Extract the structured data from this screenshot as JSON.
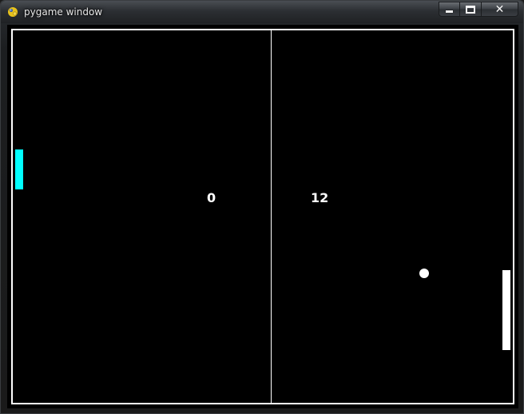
{
  "window": {
    "title": "pygame window",
    "icon": "pygame-snake-icon",
    "controls": {
      "minimize_icon": "minimize-icon",
      "maximize_icon": "maximize-icon",
      "close_icon": "close-icon",
      "close_glyph": "✕"
    }
  },
  "game": {
    "scores": {
      "left": "0",
      "right": "12"
    },
    "colors": {
      "background": "#000000",
      "court_lines": "#ffffff",
      "left_paddle": "#00ffff",
      "right_paddle": "#ffffff",
      "ball": "#ffffff"
    }
  }
}
